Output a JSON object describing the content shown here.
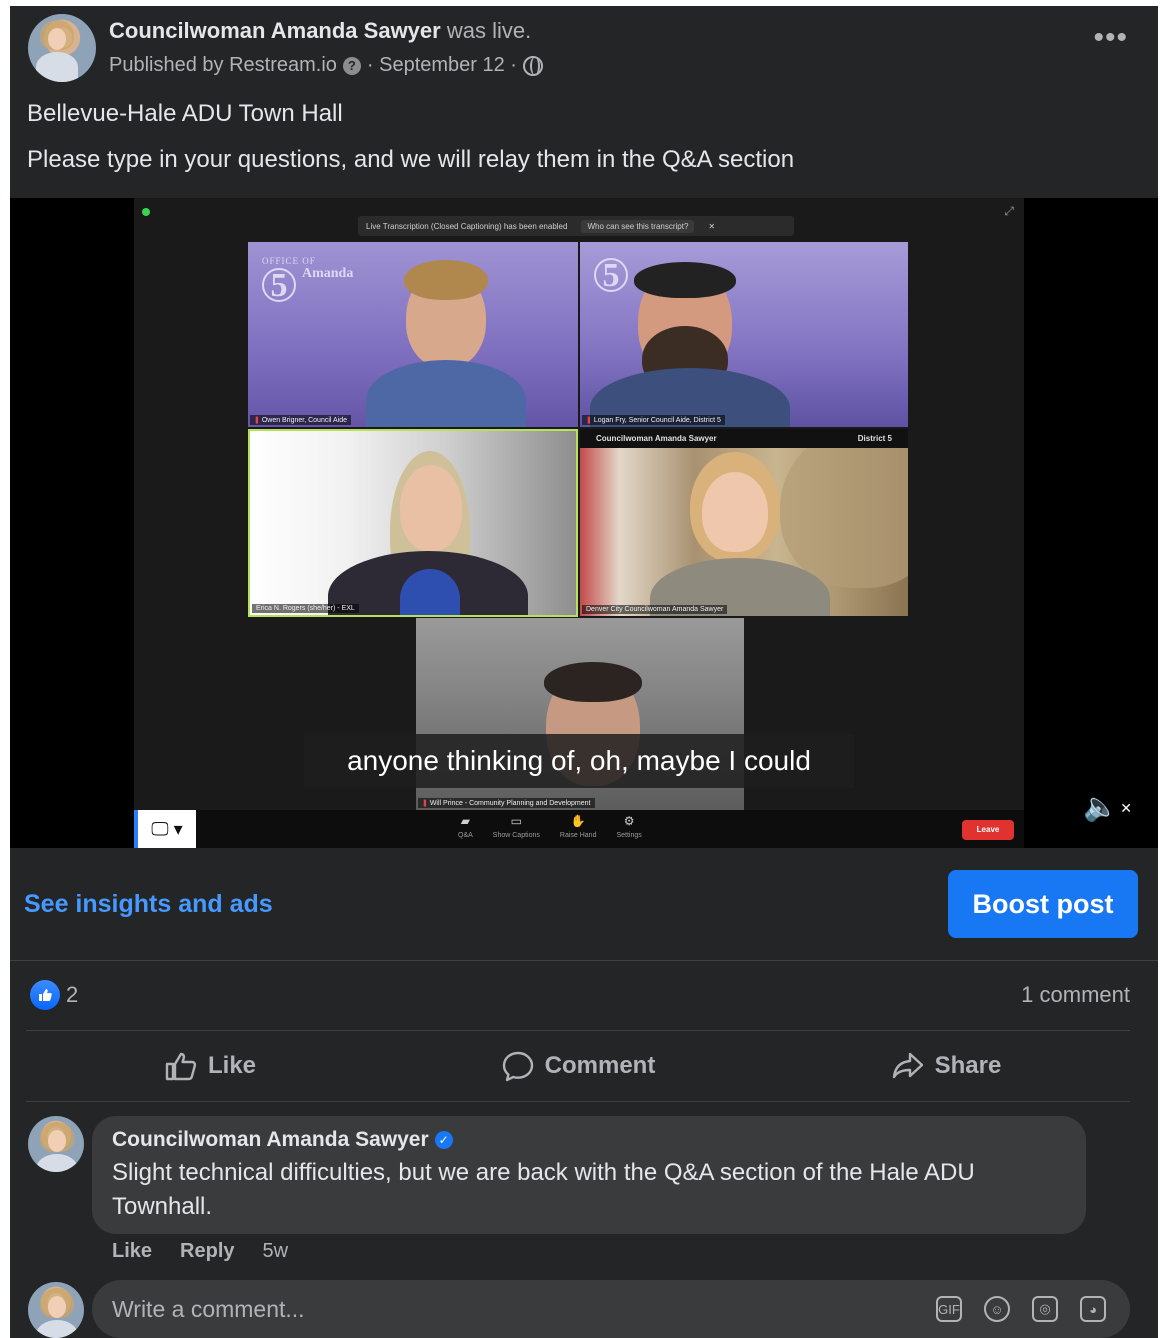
{
  "post": {
    "author": "Councilwoman Amanda Sawyer",
    "live_text": "was live.",
    "published_by": "Published by Restream.io",
    "date": "· September 12 ·",
    "title": "Bellevue-Hale ADU Town Hall",
    "description": "Please type in your questions, and we will relay them in the Q&A section"
  },
  "video": {
    "banner_text": "Live Transcription (Closed Captioning) has been enabled",
    "banner_link": "Who can see this transcript?",
    "office_small": "OFFICE OF",
    "office_number": "5",
    "office_name": "Amanda",
    "strip_left": "Councilwoman Amanda Sawyer",
    "strip_right": "District 5",
    "tiles": [
      {
        "name": "Owen Brigner, Council Aide"
      },
      {
        "name": "Logan Fry, Senior Council Aide, District 5"
      },
      {
        "name": "Erica N. Rogers (she/her) - EXL"
      },
      {
        "name": "Denver City Councilwoman Amanda Sawyer"
      },
      {
        "name": "Will Prince - Community Planning and Development"
      }
    ],
    "caption": "anyone thinking of, oh, maybe I could",
    "toolbar": {
      "qa": "Q&A",
      "captions": "Show Captions",
      "raise_hand": "Raise Hand",
      "settings": "Settings",
      "leave": "Leave"
    }
  },
  "insights": {
    "link": "See insights and ads",
    "boost": "Boost post"
  },
  "stats": {
    "likes": "2",
    "comments": "1 comment"
  },
  "actions": {
    "like": "Like",
    "comment": "Comment",
    "share": "Share"
  },
  "comment": {
    "author": "Councilwoman Amanda Sawyer",
    "text": "Slight technical difficulties, but we are back with the Q&A section of the Hale ADU Townhall.",
    "like": "Like",
    "reply": "Reply",
    "age": "5w"
  },
  "composer": {
    "placeholder": "Write a comment..."
  },
  "colors": {
    "card_bg": "#242526",
    "accent_blue": "#1877f2",
    "link_blue": "#4599ff",
    "bubble_bg": "#3a3b3c"
  },
  "icons": [
    "more-icon",
    "info-icon",
    "globe-icon",
    "like-icon",
    "comment-icon",
    "share-icon",
    "verified-icon",
    "mute-icon",
    "gif-icon",
    "emoji-icon",
    "camera-icon",
    "sticker-icon"
  ]
}
